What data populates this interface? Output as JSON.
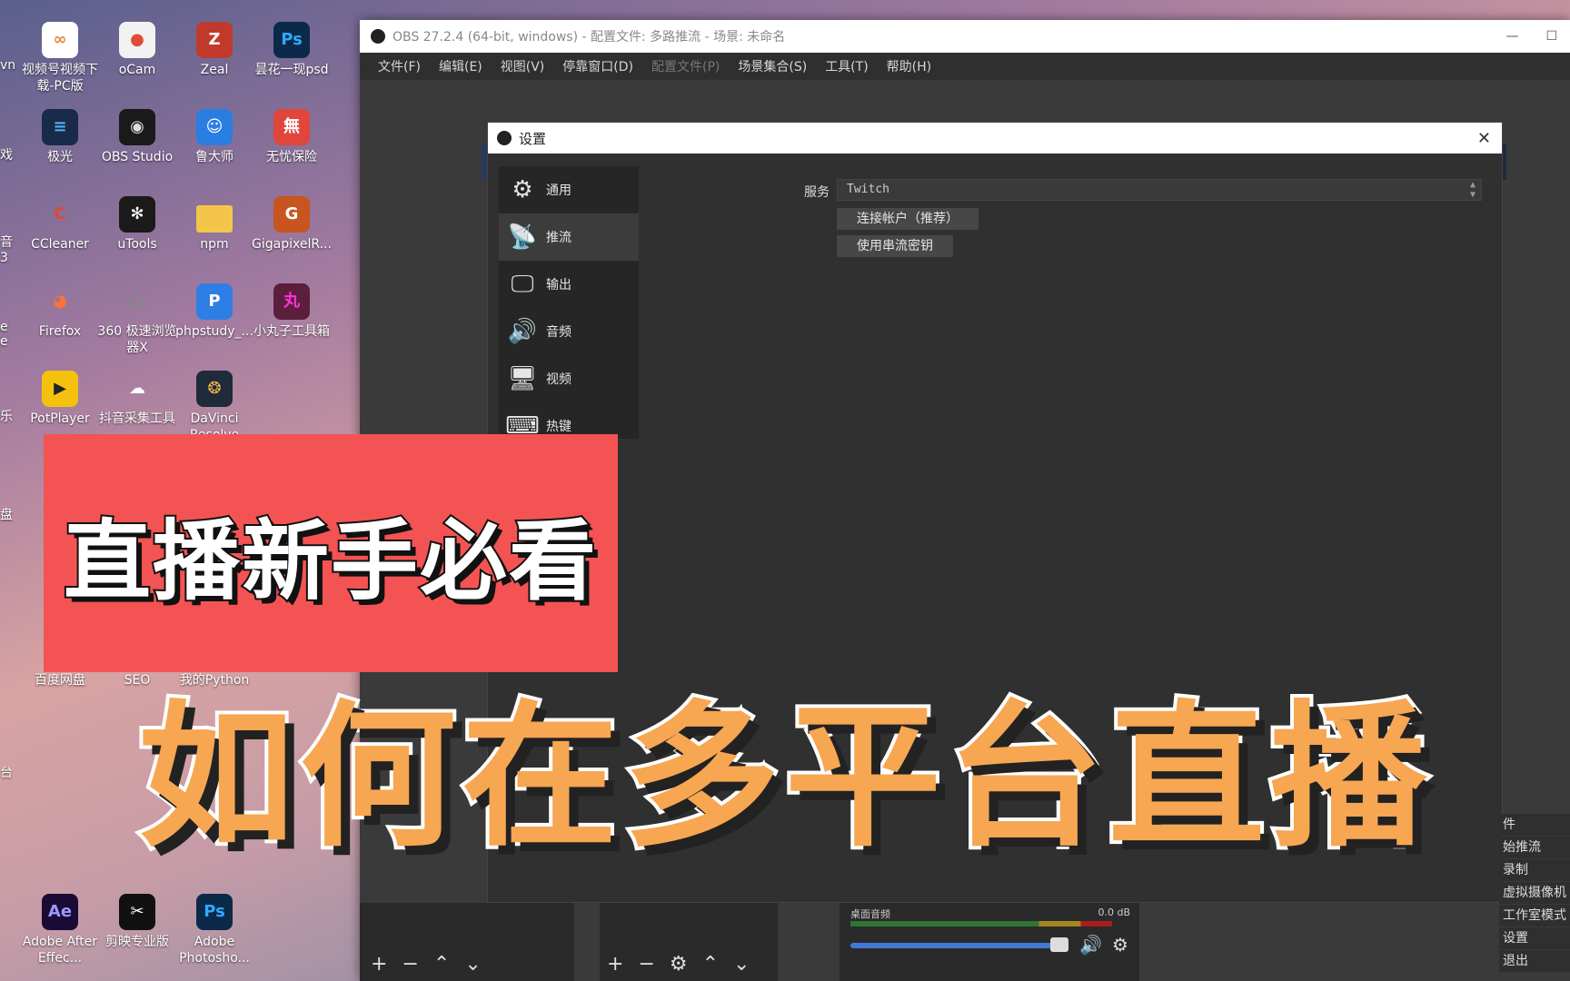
{
  "desktop": {
    "icons": [
      {
        "label": "视频号视频下载-PC版",
        "color": "#ffffff",
        "glyph": "∞",
        "glyph_color": "#e28a3e"
      },
      {
        "label": "oCam",
        "color": "#f2f2f2",
        "glyph": "●",
        "glyph_color": "#e24a3a"
      },
      {
        "label": "Zeal",
        "color": "#c0392b",
        "glyph": "Z",
        "glyph_color": "#fff"
      },
      {
        "label": "昙花一现psd",
        "color": "#0b2a4a",
        "glyph": "Ps",
        "glyph_color": "#31a8ff"
      },
      {
        "label": "极光",
        "color": "#1a2a4a",
        "glyph": "≡",
        "glyph_color": "#4ab3f4"
      },
      {
        "label": "OBS Studio",
        "color": "#1a1a1a",
        "glyph": "◉",
        "glyph_color": "#ddd"
      },
      {
        "label": "鲁大师",
        "color": "#2a7de1",
        "glyph": "☺",
        "glyph_color": "#fff"
      },
      {
        "label": "无忧保险",
        "color": "#e0463b",
        "glyph": "無",
        "glyph_color": "#fff"
      },
      {
        "label": "CCleaner",
        "color": "transparent",
        "glyph": "C",
        "glyph_color": "#e2462f"
      },
      {
        "label": "uTools",
        "color": "#1a1a1a",
        "glyph": "✻",
        "glyph_color": "#fff"
      },
      {
        "label": "npm",
        "color": "#f3c64a",
        "glyph": "",
        "glyph_color": "#fff"
      },
      {
        "label": "GigapixelR...",
        "color": "#c8551f",
        "glyph": "G",
        "glyph_color": "#fff"
      },
      {
        "label": "Firefox",
        "color": "transparent",
        "glyph": "◕",
        "glyph_color": "#ff7139"
      },
      {
        "label": "360 极速浏览器X",
        "color": "transparent",
        "glyph": "◌",
        "glyph_color": "#35b44a"
      },
      {
        "label": "phpstudy_...",
        "color": "#2f7ee6",
        "glyph": "P",
        "glyph_color": "#fff"
      },
      {
        "label": "小丸子工具箱",
        "color": "#5b1f3c",
        "glyph": "丸",
        "glyph_color": "#f3d"
      },
      {
        "label": "PotPlayer",
        "color": "#f4c20d",
        "glyph": "▶",
        "glyph_color": "#222"
      },
      {
        "label": "抖音采集工具",
        "color": "transparent",
        "glyph": "☁",
        "glyph_color": "#fff"
      },
      {
        "label": "DaVinci Resolve",
        "color": "#1d2b3a",
        "glyph": "❂",
        "glyph_color": "#f3b54a"
      },
      {
        "label": "百度网盘",
        "color": "transparent",
        "glyph": "",
        "glyph_color": "#fff"
      },
      {
        "label": "SEO",
        "color": "transparent",
        "glyph": "",
        "glyph_color": "#fff"
      },
      {
        "label": "我的Python",
        "color": "transparent",
        "glyph": "",
        "glyph_color": "#fff"
      },
      {
        "label": "Adobe After Effec...",
        "color": "#1b0a35",
        "glyph": "Ae",
        "glyph_color": "#9999ff"
      },
      {
        "label": "剪映专业版",
        "color": "#111111",
        "glyph": "✂",
        "glyph_color": "#fff"
      },
      {
        "label": "Adobe Photosho...",
        "color": "#0b2a4a",
        "glyph": "Ps",
        "glyph_color": "#31a8ff"
      }
    ],
    "edge_fragments": [
      "vn",
      "戏",
      "音\n3",
      "e\ne",
      "乐",
      "盘",
      "台"
    ]
  },
  "obs": {
    "window_title": "OBS 27.2.4 (64-bit, windows) - 配置文件: 多路推流 - 场景: 未命名",
    "menu": [
      {
        "label": "文件(F)",
        "disabled": false
      },
      {
        "label": "编辑(E)",
        "disabled": false
      },
      {
        "label": "视图(V)",
        "disabled": false
      },
      {
        "label": "停靠窗口(D)",
        "disabled": false
      },
      {
        "label": "配置文件(P)",
        "disabled": true
      },
      {
        "label": "场景集合(S)",
        "disabled": false
      },
      {
        "label": "工具(T)",
        "disabled": false
      },
      {
        "label": "帮助(H)",
        "disabled": false
      }
    ],
    "mixer": {
      "source_label": "桌面音频",
      "db_value": "0.0 dB"
    },
    "controls": [
      "件",
      "始推流",
      "录制",
      "虚拟摄像机",
      "工作室模式",
      "设置",
      "退出"
    ]
  },
  "settings": {
    "title": "设置",
    "close_glyph": "✕",
    "sidebar": [
      {
        "label": "通用",
        "icon": "gear-icon",
        "glyph": "⚙",
        "active": false
      },
      {
        "label": "推流",
        "icon": "broadcast-antenna-icon",
        "glyph": "📡",
        "active": true
      },
      {
        "label": "输出",
        "icon": "output-monitor-icon",
        "glyph": "🖵",
        "active": false
      },
      {
        "label": "音频",
        "icon": "speaker-icon",
        "glyph": "🔊",
        "active": false
      },
      {
        "label": "视频",
        "icon": "monitor-icon",
        "glyph": "🖥",
        "active": false
      },
      {
        "label": "热键",
        "icon": "keyboard-icon",
        "glyph": "⌨",
        "active": false
      }
    ],
    "service_label": "服务",
    "service_value": "Twitch",
    "connect_account_label": "连接帐户（推荐）",
    "use_stream_key_label": "使用串流密钥"
  },
  "overlay": {
    "subtitle": "直播新手必看",
    "title": "如何在多平台直播"
  },
  "colors": {
    "banner_red": "#f45353",
    "title_orange": "#f7a652",
    "obs_dark": "#2b2b2b"
  }
}
